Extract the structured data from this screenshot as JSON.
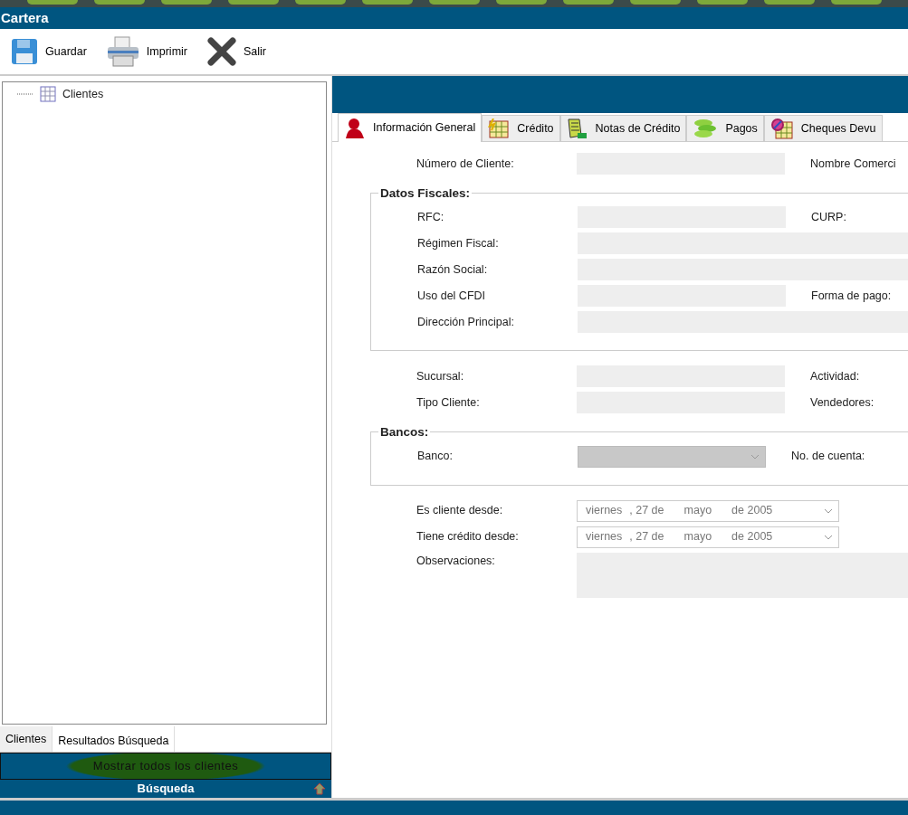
{
  "window": {
    "title": "Cartera"
  },
  "toolbar": [
    {
      "label": "Guardar"
    },
    {
      "label": "Imprimir"
    },
    {
      "label": "Salir"
    }
  ],
  "tree": {
    "items": [
      {
        "label": "Clientes"
      }
    ]
  },
  "left_tabs": [
    {
      "label": "Clientes",
      "selected": false
    },
    {
      "label": "Resultados Búsqueda",
      "selected": true
    }
  ],
  "show_all_button": {
    "label": "Mostrar todos los clientes"
  },
  "search_bar": {
    "label": "Búsqueda"
  },
  "tabs": [
    {
      "label": "Información General",
      "selected": true
    },
    {
      "label": "Crédito",
      "selected": false
    },
    {
      "label": "Notas de Crédito",
      "selected": false
    },
    {
      "label": "Pagos",
      "selected": false
    },
    {
      "label": "Cheques Devu",
      "selected": false
    }
  ],
  "sections": [
    {
      "kind": "plain",
      "rows": [
        {
          "label": "Número de Cliente:",
          "kind": "text",
          "right_label": "Nombre Comerci"
        }
      ]
    },
    {
      "kind": "group",
      "legend": "Datos Fiscales:",
      "rows": [
        {
          "label": "RFC:",
          "kind": "text",
          "right_label": "CURP:"
        },
        {
          "label": "Régimen Fiscal:",
          "kind": "wide"
        },
        {
          "label": "Razón Social:",
          "kind": "wide"
        },
        {
          "label": "Uso del CFDI",
          "kind": "text",
          "right_label": "Forma de pago:"
        },
        {
          "label": "Dirección Principal:",
          "kind": "wide"
        }
      ]
    },
    {
      "kind": "plain",
      "rows": [
        {
          "label": "Sucursal:",
          "kind": "text",
          "right_label": "Actividad:"
        },
        {
          "label": "Tipo Cliente:",
          "kind": "text",
          "right_label": "Vendedores:"
        }
      ]
    },
    {
      "kind": "group",
      "legend": "Bancos:",
      "rows": [
        {
          "label": "Banco:",
          "kind": "select",
          "disabled": true,
          "right_label": "No. de cuenta:"
        }
      ]
    },
    {
      "kind": "plain",
      "rows": [
        {
          "label": "Es cliente desde:",
          "kind": "date",
          "date": [
            "viernes",
            ", 27 de",
            "mayo",
            "de 2005"
          ]
        },
        {
          "label": "Tiene crédito desde:",
          "kind": "date",
          "date": [
            "viernes",
            ", 27 de",
            "mayo",
            "de 2005"
          ]
        },
        {
          "label": "Observaciones:",
          "kind": "area"
        }
      ]
    }
  ]
}
